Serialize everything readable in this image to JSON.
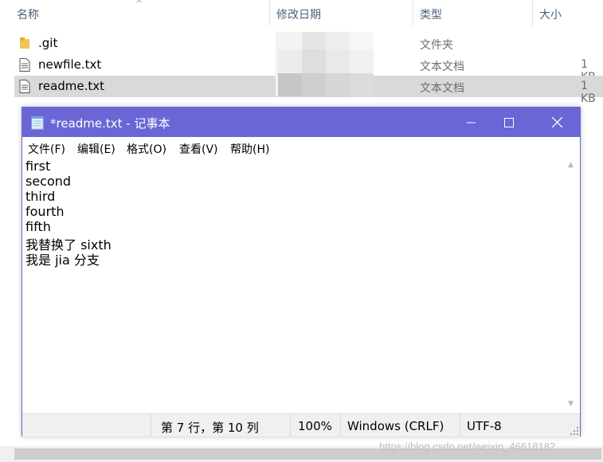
{
  "explorer": {
    "columns": {
      "name": "名称",
      "modified": "修改日期",
      "type": "类型",
      "size": "大小"
    },
    "files": [
      {
        "name": ".git",
        "type": "文件夹",
        "size": "",
        "icon": "folder-icon",
        "selected": false
      },
      {
        "name": "newfile.txt",
        "type": "文本文档",
        "size": "1 KB",
        "icon": "text-file-icon",
        "selected": false
      },
      {
        "name": "readme.txt",
        "type": "文本文档",
        "size": "1 KB",
        "icon": "text-file-icon",
        "selected": true
      }
    ]
  },
  "notepad": {
    "title": "*readme.txt - 记事本",
    "accent_color": "#6b66d6",
    "menu": [
      "文件(F)",
      "编辑(E)",
      "格式(O)",
      "查看(V)",
      "帮助(H)"
    ],
    "content_lines": [
      "first",
      "second",
      "third",
      "fourth",
      "fifth",
      "我替换了 sixth",
      "我是 jia 分支"
    ],
    "status": {
      "position": "第 7 行，第 10 列",
      "zoom": "100%",
      "line_ending": "Windows (CRLF)",
      "encoding": "UTF-8"
    }
  },
  "watermark": "https://blog.csdn.net/weixin_46618182"
}
